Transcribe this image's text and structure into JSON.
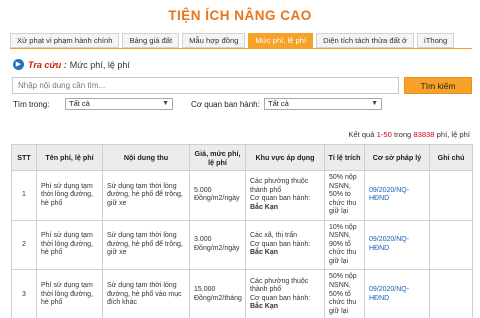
{
  "page": {
    "title": "TIỆN ÍCH NÂNG CAO"
  },
  "tabs": [
    {
      "label": "Xử phạt vi phạm hành chính",
      "active": false
    },
    {
      "label": "Bảng giá đất",
      "active": false
    },
    {
      "label": "Mẫu hợp đồng",
      "active": false
    },
    {
      "label": "Mức phí, lệ phí",
      "active": true
    },
    {
      "label": "Diện tích tách thửa đất ở",
      "active": false
    },
    {
      "label": "iThong",
      "active": false
    }
  ],
  "breadcrumb": {
    "label": "Tra cứu :",
    "value": "Mức phí, lệ phí"
  },
  "search": {
    "placeholder": "Nhập nội dung cần tìm...",
    "value": "",
    "button_label": "Tìm kiếm"
  },
  "filters": {
    "find_in_label": "Tìm trong:",
    "find_in_value": "Tất cả",
    "agency_label": "Cơ quan ban hành:",
    "agency_value": "Tất cả"
  },
  "result": {
    "prefix": "Kết quả",
    "range": "1-50",
    "middle": "trong",
    "total": "83838",
    "suffix": "phí, lệ phí"
  },
  "table": {
    "headers": [
      "STT",
      "Tên phí, lệ phí",
      "Nội dung thu",
      "Giá, mức phí, lệ phí",
      "Khu vực áp dụng",
      "Tỉ lệ trích",
      "Cơ sở pháp lý",
      "Ghi chú"
    ],
    "rows": [
      {
        "stt": "1",
        "name": "Phí sử dụng tạm thời lòng đường, hè phố",
        "content": "Sử dụng tạm thời lòng đường, hè phố để trông, giữ xe",
        "price": "5.000 Đồng/m2/ngày",
        "area_desc": "Các phường thuộc thành phố",
        "area_agency_label": "Cơ quan ban hành:",
        "area_agency": "Bắc Kạn",
        "ratio": "50% nộp NSNN, 50% to chức thu giữ lại",
        "legal": "09/2020/NQ-HĐND",
        "note": ""
      },
      {
        "stt": "2",
        "name": "Phí sử dụng tạm thời lòng đường, hè phố",
        "content": "Sử dụng tạm thời lòng đường, hè phố để trông, giữ xe",
        "price": "3.000 Đồng/m2/ngày",
        "area_desc": "Các xã, thị trấn",
        "area_agency_label": "Cơ quan ban hành:",
        "area_agency": "Bắc Kạn",
        "ratio": "10% nộp NSNN, 90% tổ chức thu giữ lại",
        "legal": "09/2020/NQ-HĐND",
        "note": ""
      },
      {
        "stt": "3",
        "name": "Phí sử dụng tạm thời lòng đường, hè phố",
        "content": "Sử dụng tạm thời lòng đường, hè phố vào mục đích khác",
        "price": "15.000 Đồng/m2/tháng",
        "area_desc": "Các phường thuộc thành phố",
        "area_agency_label": "Cơ quan ban hành:",
        "area_agency": "Bắc Kạn",
        "ratio": "50% nộp NSNN, 50% tổ chức thu giữ lại",
        "legal": "09/2020/NQ-HĐND",
        "note": ""
      }
    ]
  }
}
